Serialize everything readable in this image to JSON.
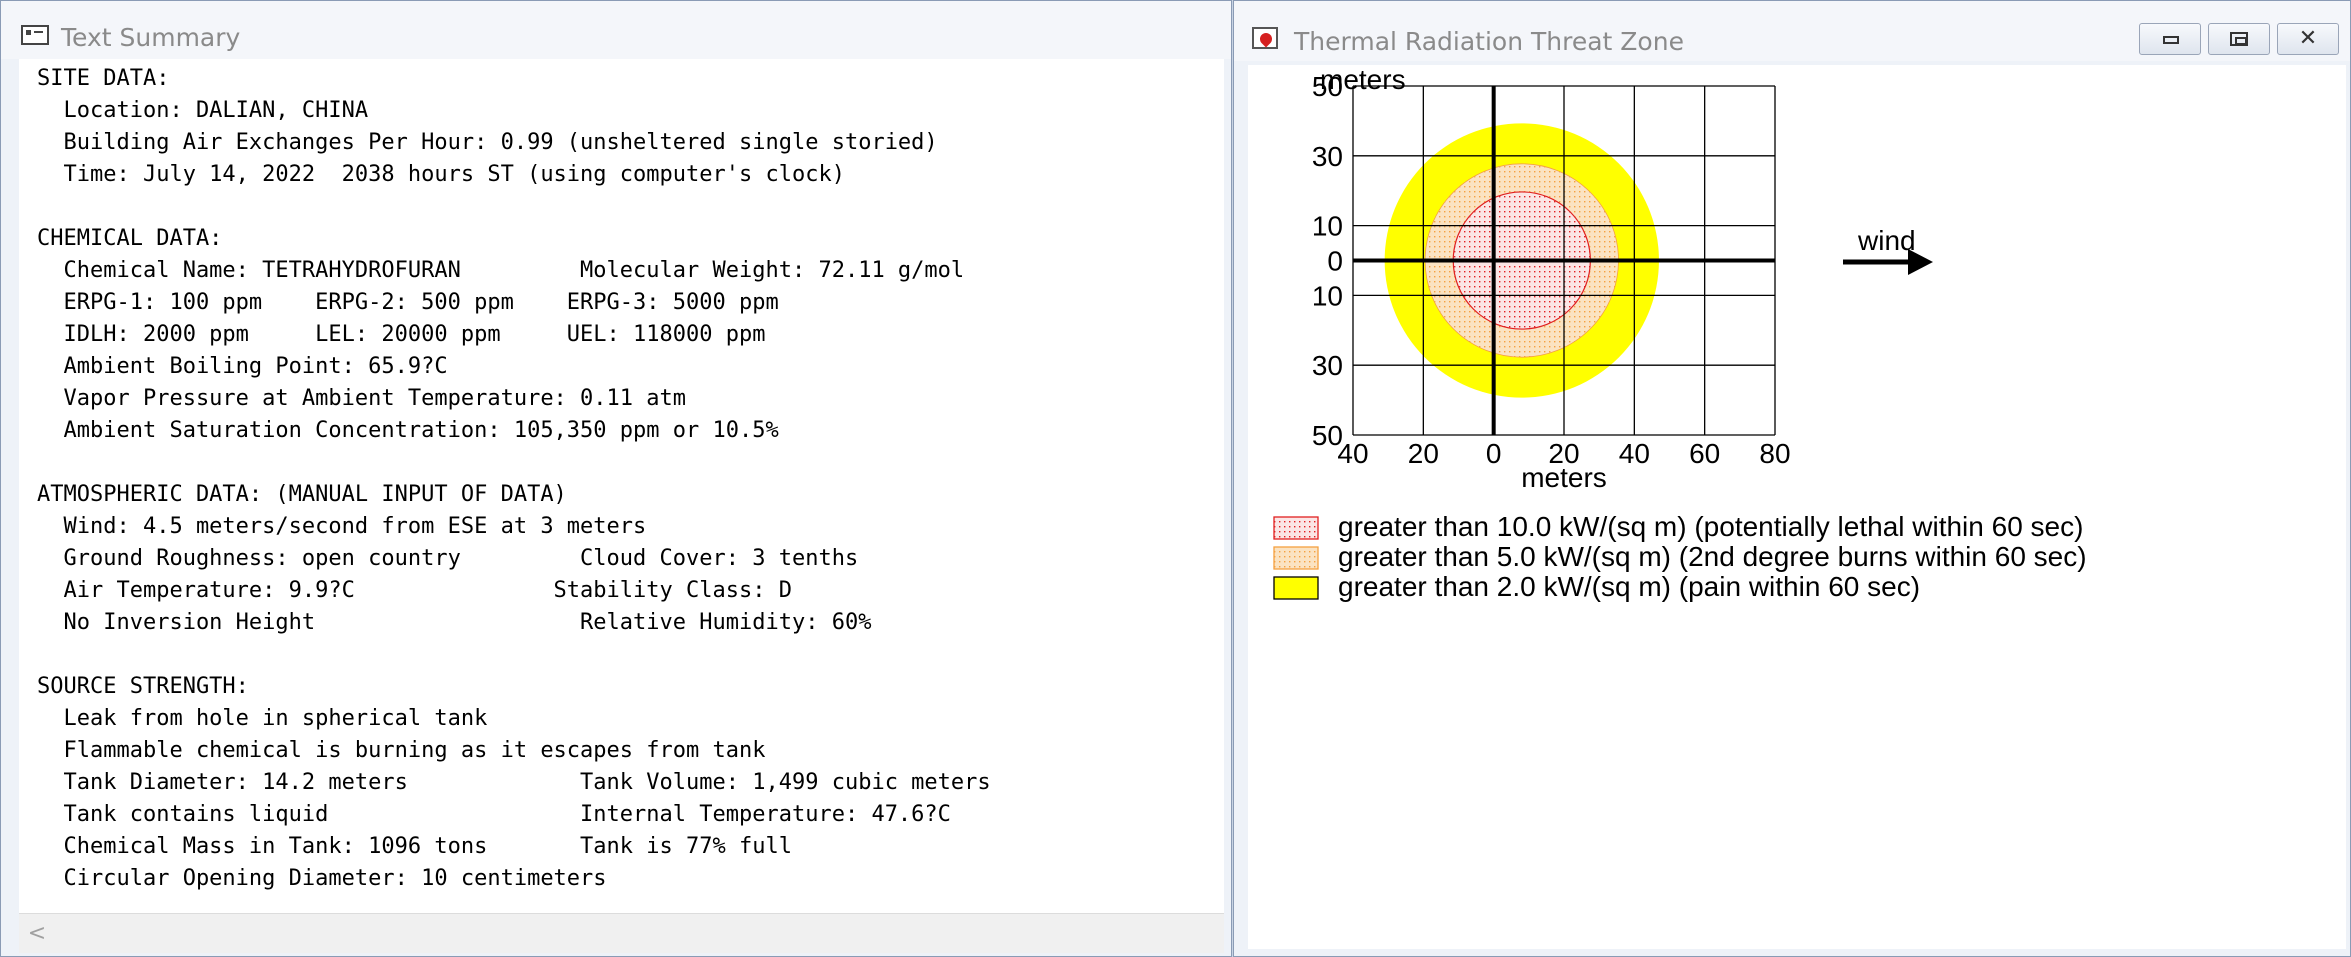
{
  "text_summary": {
    "title": "Text Summary",
    "lines": [
      "SITE DATA:",
      "  Location: DALIAN, CHINA",
      "  Building Air Exchanges Per Hour: 0.99 (unsheltered single storied)",
      "  Time: July 14, 2022  2038 hours ST (using computer's clock)",
      "",
      "CHEMICAL DATA:",
      "  Chemical Name: TETRAHYDROFURAN         Molecular Weight: 72.11 g/mol",
      "  ERPG-1: 100 ppm    ERPG-2: 500 ppm    ERPG-3: 5000 ppm",
      "  IDLH: 2000 ppm     LEL: 20000 ppm     UEL: 118000 ppm",
      "  Ambient Boiling Point: 65.9?C",
      "  Vapor Pressure at Ambient Temperature: 0.11 atm",
      "  Ambient Saturation Concentration: 105,350 ppm or 10.5%",
      "",
      "ATMOSPHERIC DATA: (MANUAL INPUT OF DATA)",
      "  Wind: 4.5 meters/second from ESE at 3 meters",
      "  Ground Roughness: open country         Cloud Cover: 3 tenths",
      "  Air Temperature: 9.9?C               Stability Class: D",
      "  No Inversion Height                    Relative Humidity: 60%",
      "",
      "SOURCE STRENGTH:",
      "  Leak from hole in spherical tank",
      "  Flammable chemical is burning as it escapes from tank",
      "  Tank Diameter: 14.2 meters             Tank Volume: 1,499 cubic meters",
      "  Tank contains liquid                   Internal Temperature: 47.6?C",
      "  Chemical Mass in Tank: 1096 tons       Tank is 77% full",
      "  Circular Opening Diameter: 10 centimeters"
    ],
    "scroll_left_glyph": "<"
  },
  "thermal_window": {
    "title": "Thermal Radiation Threat Zone",
    "controls": {
      "close_glyph": "✕"
    }
  },
  "chart_data": {
    "type": "threat_zone",
    "y_axis_title": "meters",
    "x_axis_title": "meters",
    "xlim": [
      -40,
      80
    ],
    "ylim": [
      -50,
      50
    ],
    "x_ticks": [
      -40,
      -20,
      0,
      20,
      40,
      60,
      80
    ],
    "x_tick_labels": [
      "40",
      "20",
      "0",
      "20",
      "40",
      "60",
      "80"
    ],
    "y_ticks": [
      50,
      30,
      10,
      0,
      -10,
      -30,
      -50
    ],
    "y_tick_labels": [
      "50",
      "30",
      "10",
      "0",
      "10",
      "30",
      "50"
    ],
    "grid_x": [
      -40,
      -20,
      0,
      20,
      40,
      60,
      80
    ],
    "grid_y": [
      50,
      30,
      10,
      -10,
      -30,
      -50
    ],
    "zones": [
      {
        "name": "yellow",
        "center_x": 8,
        "center_y": 0,
        "radius": 39,
        "color": "#ffff00",
        "pattern": "solid",
        "label": "greater than 2.0 kW/(sq m) (pain within 60 sec)"
      },
      {
        "name": "orange",
        "center_x": 8,
        "center_y": 0,
        "radius": 27.5,
        "color": "#f5a040",
        "pattern": "dotted",
        "label": "greater than 5.0 kW/(sq m) (2nd degree burns within 60 sec)"
      },
      {
        "name": "red",
        "center_x": 8,
        "center_y": 0,
        "radius": 19.5,
        "color": "#e02020",
        "pattern": "dotted",
        "label": "greater than 10.0 kW/(sq m) (potentially lethal within 60 sec)"
      }
    ],
    "legend_order": [
      "red",
      "orange",
      "yellow"
    ],
    "wind_label": "wind"
  }
}
